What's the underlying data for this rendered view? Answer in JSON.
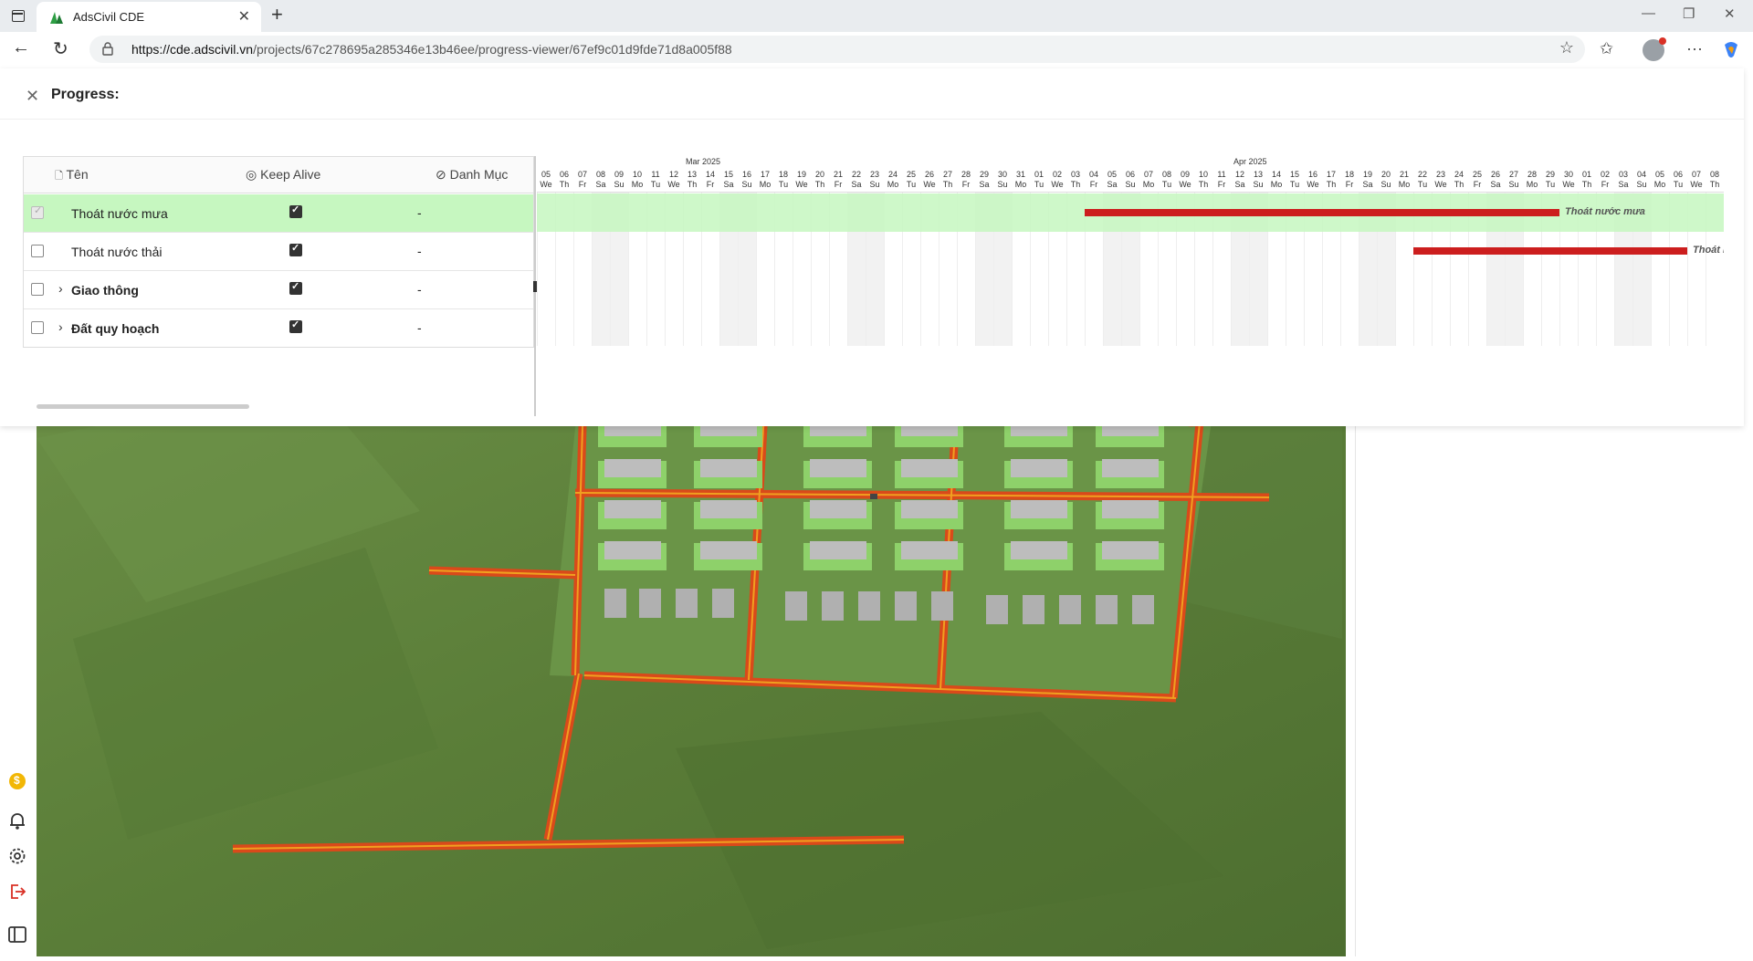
{
  "browser": {
    "tab_title": "AdsCivil CDE",
    "url_host": "https://cde.adscivil.vn",
    "url_path": "/projects/67c278695a285346e13b46ee/progress-viewer/67ef9c01d9fde71d8a005f88"
  },
  "panel": {
    "title": "Progress:"
  },
  "table": {
    "columns": [
      "Tên",
      "Keep Alive",
      "Danh Mục"
    ],
    "rows": [
      {
        "name": "Thoát nước mưa",
        "keep_alive": true,
        "category": "-",
        "selected": true,
        "group": false
      },
      {
        "name": "Thoát nước thải",
        "keep_alive": true,
        "category": "-",
        "selected": false,
        "group": false
      },
      {
        "name": "Giao thông",
        "keep_alive": true,
        "category": "-",
        "selected": false,
        "group": true
      },
      {
        "name": "Đất quy hoạch",
        "keep_alive": true,
        "category": "-",
        "selected": false,
        "group": true
      }
    ]
  },
  "gantt": {
    "months": [
      "Mar 2025",
      "Apr 2025"
    ],
    "days": [
      [
        "05",
        "We"
      ],
      [
        "06",
        "Th"
      ],
      [
        "07",
        "Fr"
      ],
      [
        "08",
        "Sa"
      ],
      [
        "09",
        "Su"
      ],
      [
        "10",
        "Mo"
      ],
      [
        "11",
        "Tu"
      ],
      [
        "12",
        "We"
      ],
      [
        "13",
        "Th"
      ],
      [
        "14",
        "Fr"
      ],
      [
        "15",
        "Sa"
      ],
      [
        "16",
        "Su"
      ],
      [
        "17",
        "Mo"
      ],
      [
        "18",
        "Tu"
      ],
      [
        "19",
        "We"
      ],
      [
        "20",
        "Th"
      ],
      [
        "21",
        "Fr"
      ],
      [
        "22",
        "Sa"
      ],
      [
        "23",
        "Su"
      ],
      [
        "24",
        "Mo"
      ],
      [
        "25",
        "Tu"
      ],
      [
        "26",
        "We"
      ],
      [
        "27",
        "Th"
      ],
      [
        "28",
        "Fr"
      ],
      [
        "29",
        "Sa"
      ],
      [
        "30",
        "Su"
      ],
      [
        "31",
        "Mo"
      ],
      [
        "01",
        "Tu"
      ],
      [
        "02",
        "We"
      ],
      [
        "03",
        "Th"
      ],
      [
        "04",
        "Fr"
      ],
      [
        "05",
        "Sa"
      ],
      [
        "06",
        "Su"
      ],
      [
        "07",
        "Mo"
      ],
      [
        "08",
        "Tu"
      ],
      [
        "09",
        "We"
      ],
      [
        "10",
        "Th"
      ],
      [
        "11",
        "Fr"
      ],
      [
        "12",
        "Sa"
      ],
      [
        "13",
        "Su"
      ],
      [
        "14",
        "Mo"
      ],
      [
        "15",
        "Tu"
      ],
      [
        "16",
        "We"
      ],
      [
        "17",
        "Th"
      ],
      [
        "18",
        "Fr"
      ],
      [
        "19",
        "Sa"
      ],
      [
        "20",
        "Su"
      ],
      [
        "21",
        "Mo"
      ],
      [
        "22",
        "Tu"
      ],
      [
        "23",
        "We"
      ],
      [
        "24",
        "Th"
      ],
      [
        "25",
        "Fr"
      ],
      [
        "26",
        "Sa"
      ],
      [
        "27",
        "Su"
      ],
      [
        "28",
        "Mo"
      ],
      [
        "29",
        "Tu"
      ],
      [
        "30",
        "We"
      ],
      [
        "01",
        "Th"
      ],
      [
        "02",
        "Fr"
      ],
      [
        "03",
        "Sa"
      ],
      [
        "04",
        "Su"
      ],
      [
        "05",
        "Mo"
      ],
      [
        "06",
        "Tu"
      ],
      [
        "07",
        "We"
      ],
      [
        "08",
        "Th"
      ]
    ],
    "bars": [
      {
        "row": 0,
        "start": "2025-04-04",
        "end": "2025-04-30",
        "label": "Thoát nước mưa"
      },
      {
        "row": 1,
        "start": "2025-04-22",
        "end": "2025-05-07",
        "label": "Thoát nước thải"
      }
    ],
    "bar_color": "#cc1e1e",
    "selected_row_color": "#c6f7c0"
  },
  "rail": {
    "icons": [
      "coin-icon",
      "bell-icon",
      "gear-icon",
      "logout-icon",
      "sidebar-toggle-icon"
    ],
    "coin_label": "$"
  }
}
